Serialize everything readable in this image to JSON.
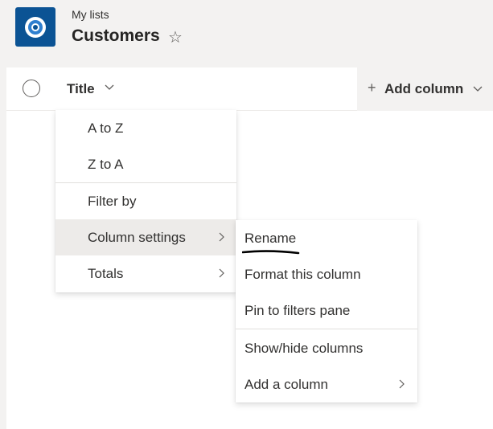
{
  "header": {
    "breadcrumb": "My lists",
    "title": "Customers",
    "star_icon": "star-outline-icon",
    "app_icon": "lists-app-icon",
    "app_icon_color": "#0b5394"
  },
  "list": {
    "columns": [
      {
        "label": "Title"
      }
    ],
    "add_column": {
      "plus": "+",
      "label": "Add column"
    }
  },
  "column_menu": {
    "items": [
      {
        "label": "A to Z"
      },
      {
        "label": "Z to A"
      },
      {
        "label": "Filter by"
      },
      {
        "label": "Column settings",
        "has_submenu": true,
        "active": true
      },
      {
        "label": "Totals",
        "has_submenu": true
      }
    ]
  },
  "settings_submenu": {
    "items": [
      {
        "label": "Rename"
      },
      {
        "label": "Format this column"
      },
      {
        "label": "Pin to filters pane"
      },
      {
        "label": "Show/hide columns"
      },
      {
        "label": "Add a column",
        "has_submenu": true
      }
    ]
  },
  "colors": {
    "background": "#f3f2f1",
    "surface": "#ffffff",
    "active_item": "#edebe9",
    "text": "#323130"
  }
}
